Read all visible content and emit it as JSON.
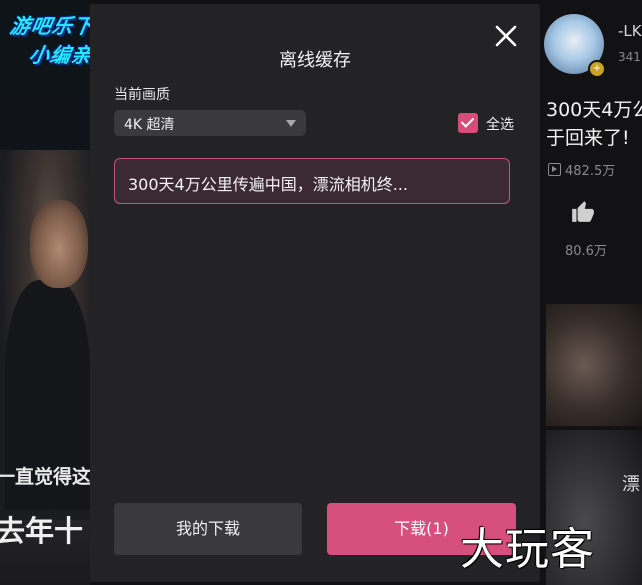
{
  "watermark_top_left": {
    "line1": "游吧乐下载",
    "line2": "小编亲测"
  },
  "watermark_bottom_right": "大玩客",
  "background_left": {
    "caption1": "一直觉得这",
    "caption2": "去年十"
  },
  "background_right": {
    "author": "-LK",
    "followers": "341",
    "title_line1": "300天4万公",
    "title_line2": "于回来了!",
    "plays": "482.5万",
    "likes": "80.6万",
    "thumb_text": "漂"
  },
  "dialog": {
    "title": "离线缓存",
    "close_icon": "close-icon",
    "quality_label": "当前画质",
    "quality_value": "4K 超清",
    "select_all_label": "全选",
    "select_all_checked": true,
    "items": [
      {
        "title": "300天4万公里传遍中国，漂流相机终...",
        "selected": true
      }
    ],
    "my_downloads_label": "我的下载",
    "download_label": "下载(1)"
  },
  "colors": {
    "accent": "#d64f7d",
    "dialog_bg": "#232326",
    "button_bg": "#3a3a3d"
  }
}
